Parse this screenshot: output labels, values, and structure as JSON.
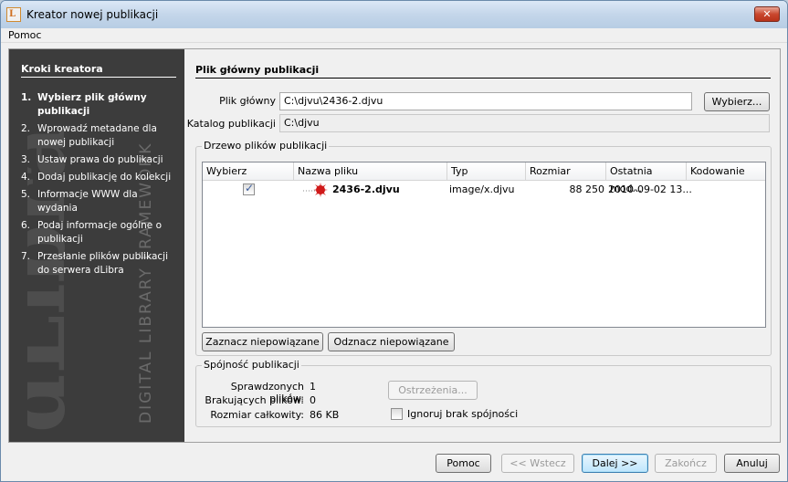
{
  "window": {
    "title": "Kreator nowej publikacji",
    "close_glyph": "✕",
    "icon_letter": "L"
  },
  "menu": {
    "items": [
      "Pomoc"
    ]
  },
  "sidebar": {
    "title": "Kroki kreatora",
    "steps": [
      {
        "num": "1.",
        "label": "Wybierz plik główny publikacji",
        "active": true
      },
      {
        "num": "2.",
        "label": "Wprowadź metadane dla nowej publikacji",
        "active": false
      },
      {
        "num": "3.",
        "label": "Ustaw prawa do publikacji",
        "active": false
      },
      {
        "num": "4.",
        "label": "Dodaj publikację do kolekcji",
        "active": false
      },
      {
        "num": "5.",
        "label": "Informacje WWW dla wydania",
        "active": false
      },
      {
        "num": "6.",
        "label": "Podaj informacje ogólne o publikacji",
        "active": false
      },
      {
        "num": "7.",
        "label": "Przesłanie plików publikacji do serwera dLibra",
        "active": false
      }
    ],
    "watermark_logo": "dLibra",
    "watermark_caption": "DIGITAL LIBRARY FRAMEWORK"
  },
  "main": {
    "section_title": "Plik główny publikacji",
    "main_file_label": "Plik główny",
    "main_file_value": "C:\\djvu\\2436-2.djvu",
    "choose_button": "Wybierz...",
    "catalog_label": "Katalog publikacji",
    "catalog_value": "C:\\djvu"
  },
  "file_tree": {
    "legend": "Drzewo plików publikacji",
    "columns": [
      "Wybierz",
      "Nazwa pliku",
      "Typ",
      "Rozmiar",
      "Ostatnia mod...",
      "Kodowanie"
    ],
    "rows": [
      {
        "selected": true,
        "name": "2436-2.djvu",
        "type": "image/x.djvu",
        "size": "88 250",
        "modified": "2010-09-02 13...",
        "encoding": ""
      }
    ],
    "mark_button": "Zaznacz niepowiązane",
    "unmark_button": "Odznacz niepowiązane"
  },
  "consistency": {
    "legend": "Spójność publikacji",
    "checked_label": "Sprawdzonych plików:",
    "checked_value": "1",
    "missing_label": "Brakujących plików:",
    "missing_value": "0",
    "total_label": "Rozmiar całkowity:",
    "total_value": "86 KB",
    "warnings_button": "Ostrzeżenia...",
    "ignore_label": "Ignoruj brak spójności"
  },
  "footer": {
    "help": "Pomoc",
    "back": "<< Wstecz",
    "next": "Dalej >>",
    "finish": "Zakończ",
    "cancel": "Anuluj"
  }
}
